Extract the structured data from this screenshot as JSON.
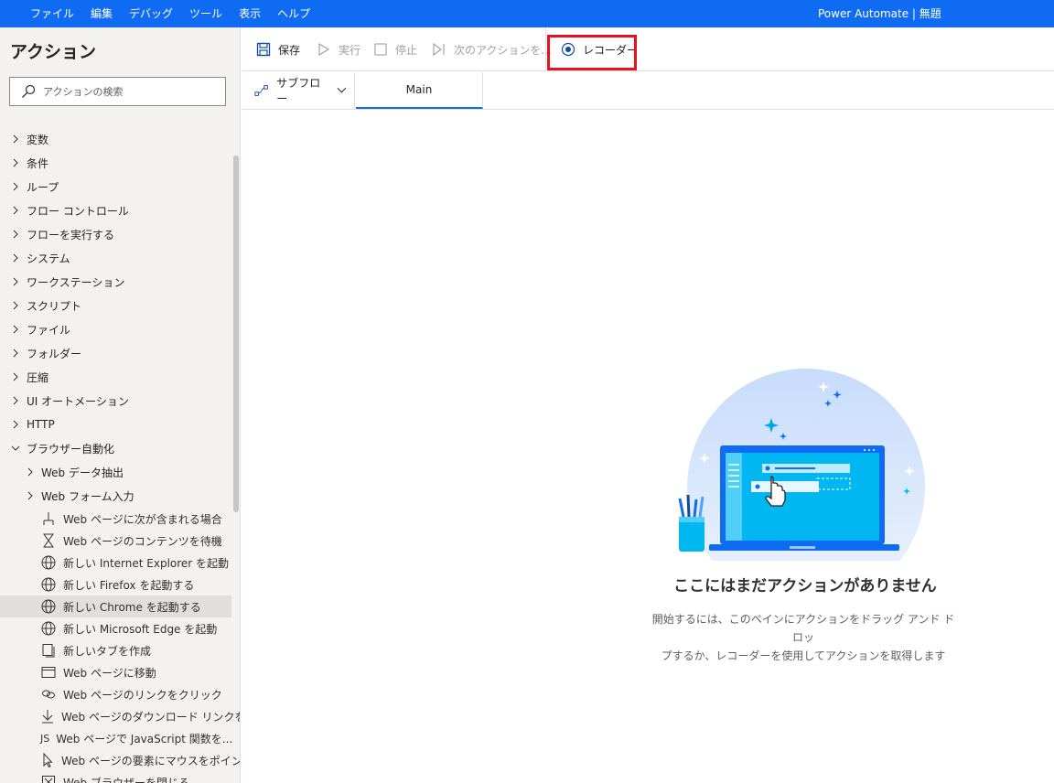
{
  "menubar": {
    "items": [
      "ファイル",
      "編集",
      "デバッグ",
      "ツール",
      "表示",
      "ヘルプ"
    ],
    "title": "Power Automate | 無題"
  },
  "sidebar": {
    "title": "アクション",
    "search_placeholder": "アクションの検索",
    "categories": [
      "変数",
      "条件",
      "ループ",
      "フロー コントロール",
      "フローを実行する",
      "システム",
      "ワークステーション",
      "スクリプト",
      "ファイル",
      "フォルダー",
      "圧縮",
      "UI オートメーション",
      "HTTP"
    ],
    "expanded_category": "ブラウザー自動化",
    "subcategories": [
      "Web データ抽出",
      "Web フォーム入力"
    ],
    "actions": [
      {
        "label": "Web ページに次が含まれる場合",
        "icon": "branch-icon",
        "selected": false
      },
      {
        "label": "Web ページのコンテンツを待機",
        "icon": "hourglass-icon",
        "selected": false
      },
      {
        "label": "新しい Internet Explorer を起動",
        "icon": "globe-icon",
        "selected": false
      },
      {
        "label": "新しい Firefox を起動する",
        "icon": "globe-icon",
        "selected": false
      },
      {
        "label": "新しい Chrome を起動する",
        "icon": "globe-icon",
        "selected": true
      },
      {
        "label": "新しい Microsoft Edge を起動",
        "icon": "globe-icon",
        "selected": false
      },
      {
        "label": "新しいタブを作成",
        "icon": "new-tab-icon",
        "selected": false
      },
      {
        "label": "Web ページに移動",
        "icon": "window-icon",
        "selected": false
      },
      {
        "label": "Web ページのリンクをクリック",
        "icon": "link-icon",
        "selected": false
      },
      {
        "label": "Web ページのダウンロード リンクをク...",
        "icon": "download-icon",
        "selected": false
      },
      {
        "label": "Web ページで JavaScript 関数を...",
        "icon": "js-icon",
        "selected": false
      },
      {
        "label": "Web ページの要素にマウスをポイント",
        "icon": "pointer-icon",
        "selected": false
      },
      {
        "label": "Web ブラウザーを閉じる",
        "icon": "close-window-icon",
        "selected": false
      }
    ]
  },
  "toolbar": {
    "save": "保存",
    "run": "実行",
    "stop": "停止",
    "next_action": "次のアクションを...",
    "recorder": "レコーダー"
  },
  "tabs": {
    "subflow": "サブフロー",
    "main": "Main"
  },
  "empty_state": {
    "title": "ここにはまだアクションがありません",
    "description_line1": "開始するには、このペインにアクションをドラッグ アンド ドロッ",
    "description_line2": "プするか、レコーダーを使用してアクションを取得します"
  },
  "colors": {
    "accent": "#0f6cf2",
    "highlight": "#e81123",
    "sidebar_bg": "#f3f2f1"
  }
}
